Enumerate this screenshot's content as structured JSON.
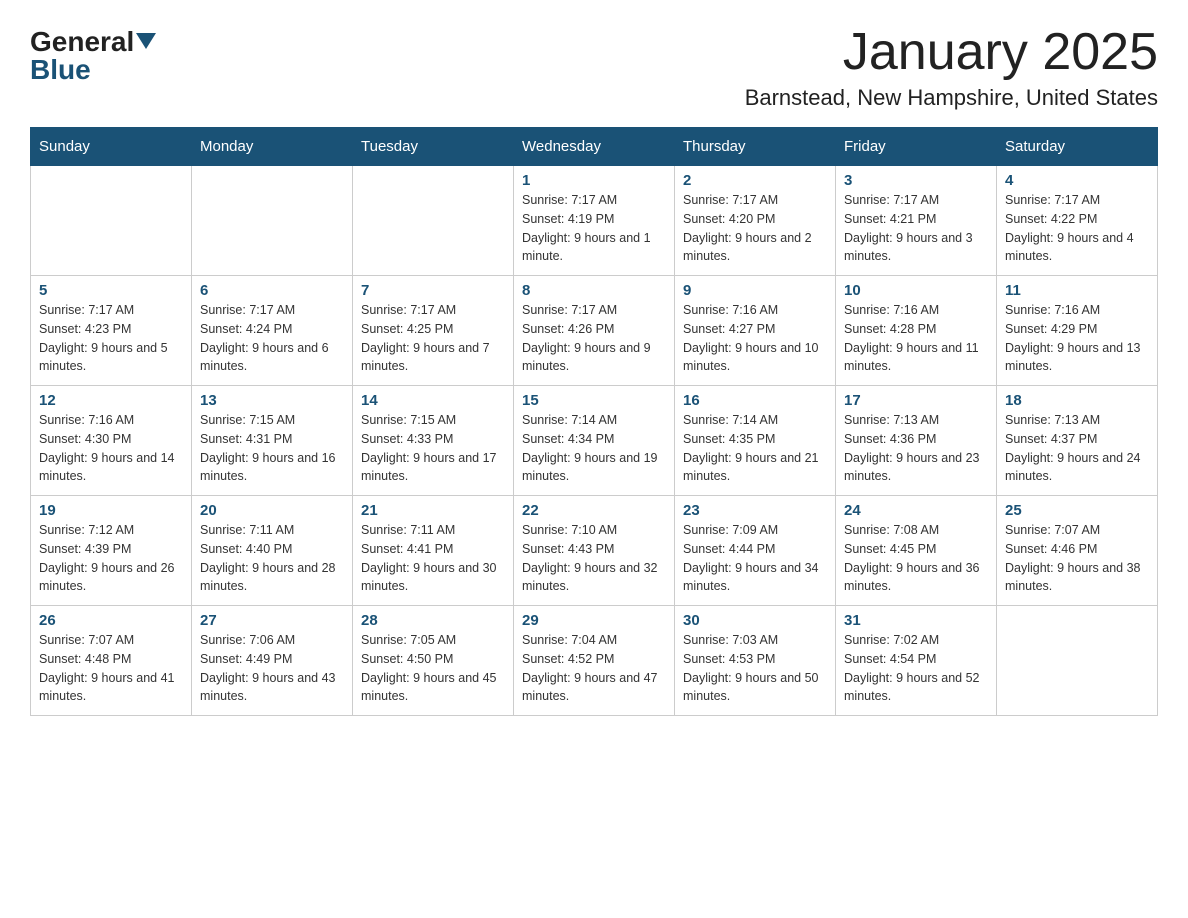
{
  "logo": {
    "text1": "General",
    "text2": "Blue"
  },
  "title": "January 2025",
  "subtitle": "Barnstead, New Hampshire, United States",
  "days_of_week": [
    "Sunday",
    "Monday",
    "Tuesday",
    "Wednesday",
    "Thursday",
    "Friday",
    "Saturday"
  ],
  "weeks": [
    [
      {
        "day": "",
        "info": ""
      },
      {
        "day": "",
        "info": ""
      },
      {
        "day": "",
        "info": ""
      },
      {
        "day": "1",
        "info": "Sunrise: 7:17 AM\nSunset: 4:19 PM\nDaylight: 9 hours and 1 minute."
      },
      {
        "day": "2",
        "info": "Sunrise: 7:17 AM\nSunset: 4:20 PM\nDaylight: 9 hours and 2 minutes."
      },
      {
        "day": "3",
        "info": "Sunrise: 7:17 AM\nSunset: 4:21 PM\nDaylight: 9 hours and 3 minutes."
      },
      {
        "day": "4",
        "info": "Sunrise: 7:17 AM\nSunset: 4:22 PM\nDaylight: 9 hours and 4 minutes."
      }
    ],
    [
      {
        "day": "5",
        "info": "Sunrise: 7:17 AM\nSunset: 4:23 PM\nDaylight: 9 hours and 5 minutes."
      },
      {
        "day": "6",
        "info": "Sunrise: 7:17 AM\nSunset: 4:24 PM\nDaylight: 9 hours and 6 minutes."
      },
      {
        "day": "7",
        "info": "Sunrise: 7:17 AM\nSunset: 4:25 PM\nDaylight: 9 hours and 7 minutes."
      },
      {
        "day": "8",
        "info": "Sunrise: 7:17 AM\nSunset: 4:26 PM\nDaylight: 9 hours and 9 minutes."
      },
      {
        "day": "9",
        "info": "Sunrise: 7:16 AM\nSunset: 4:27 PM\nDaylight: 9 hours and 10 minutes."
      },
      {
        "day": "10",
        "info": "Sunrise: 7:16 AM\nSunset: 4:28 PM\nDaylight: 9 hours and 11 minutes."
      },
      {
        "day": "11",
        "info": "Sunrise: 7:16 AM\nSunset: 4:29 PM\nDaylight: 9 hours and 13 minutes."
      }
    ],
    [
      {
        "day": "12",
        "info": "Sunrise: 7:16 AM\nSunset: 4:30 PM\nDaylight: 9 hours and 14 minutes."
      },
      {
        "day": "13",
        "info": "Sunrise: 7:15 AM\nSunset: 4:31 PM\nDaylight: 9 hours and 16 minutes."
      },
      {
        "day": "14",
        "info": "Sunrise: 7:15 AM\nSunset: 4:33 PM\nDaylight: 9 hours and 17 minutes."
      },
      {
        "day": "15",
        "info": "Sunrise: 7:14 AM\nSunset: 4:34 PM\nDaylight: 9 hours and 19 minutes."
      },
      {
        "day": "16",
        "info": "Sunrise: 7:14 AM\nSunset: 4:35 PM\nDaylight: 9 hours and 21 minutes."
      },
      {
        "day": "17",
        "info": "Sunrise: 7:13 AM\nSunset: 4:36 PM\nDaylight: 9 hours and 23 minutes."
      },
      {
        "day": "18",
        "info": "Sunrise: 7:13 AM\nSunset: 4:37 PM\nDaylight: 9 hours and 24 minutes."
      }
    ],
    [
      {
        "day": "19",
        "info": "Sunrise: 7:12 AM\nSunset: 4:39 PM\nDaylight: 9 hours and 26 minutes."
      },
      {
        "day": "20",
        "info": "Sunrise: 7:11 AM\nSunset: 4:40 PM\nDaylight: 9 hours and 28 minutes."
      },
      {
        "day": "21",
        "info": "Sunrise: 7:11 AM\nSunset: 4:41 PM\nDaylight: 9 hours and 30 minutes."
      },
      {
        "day": "22",
        "info": "Sunrise: 7:10 AM\nSunset: 4:43 PM\nDaylight: 9 hours and 32 minutes."
      },
      {
        "day": "23",
        "info": "Sunrise: 7:09 AM\nSunset: 4:44 PM\nDaylight: 9 hours and 34 minutes."
      },
      {
        "day": "24",
        "info": "Sunrise: 7:08 AM\nSunset: 4:45 PM\nDaylight: 9 hours and 36 minutes."
      },
      {
        "day": "25",
        "info": "Sunrise: 7:07 AM\nSunset: 4:46 PM\nDaylight: 9 hours and 38 minutes."
      }
    ],
    [
      {
        "day": "26",
        "info": "Sunrise: 7:07 AM\nSunset: 4:48 PM\nDaylight: 9 hours and 41 minutes."
      },
      {
        "day": "27",
        "info": "Sunrise: 7:06 AM\nSunset: 4:49 PM\nDaylight: 9 hours and 43 minutes."
      },
      {
        "day": "28",
        "info": "Sunrise: 7:05 AM\nSunset: 4:50 PM\nDaylight: 9 hours and 45 minutes."
      },
      {
        "day": "29",
        "info": "Sunrise: 7:04 AM\nSunset: 4:52 PM\nDaylight: 9 hours and 47 minutes."
      },
      {
        "day": "30",
        "info": "Sunrise: 7:03 AM\nSunset: 4:53 PM\nDaylight: 9 hours and 50 minutes."
      },
      {
        "day": "31",
        "info": "Sunrise: 7:02 AM\nSunset: 4:54 PM\nDaylight: 9 hours and 52 minutes."
      },
      {
        "day": "",
        "info": ""
      }
    ]
  ]
}
